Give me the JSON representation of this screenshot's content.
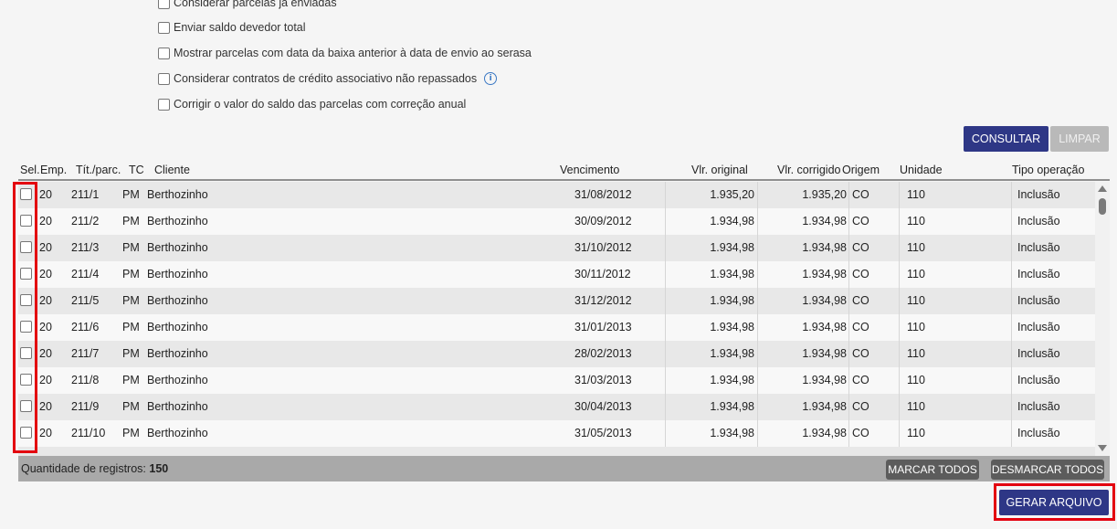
{
  "options": [
    {
      "label": "Considerar parcelas já enviadas"
    },
    {
      "label": "Enviar saldo devedor total"
    },
    {
      "label": "Mostrar parcelas com data da baixa anterior à data de envio ao serasa"
    },
    {
      "label": "Considerar contratos de crédito associativo não repassados"
    },
    {
      "label": "Corrigir o valor do saldo das parcelas com correção anual"
    }
  ],
  "info_icon": "info-icon",
  "buttons": {
    "consultar": "CONSULTAR",
    "limpar": "LIMPAR",
    "marcar_todos": "MARCAR TODOS",
    "desmarcar_todos": "DESMARCAR TODOS",
    "gerar_arquivo": "GERAR ARQUIVO"
  },
  "table": {
    "columns": {
      "sel": "Sel.",
      "emp": "Emp.",
      "tit": "Tít./parc.",
      "tc": "TC",
      "cliente": "Cliente",
      "vencimento": "Vencimento",
      "vlr_original": "Vlr. original",
      "vlr_corrigido": "Vlr. corrigido",
      "origem": "Origem",
      "unidade": "Unidade",
      "tipo_operacao": "Tipo operação"
    },
    "rows": [
      {
        "emp": "20",
        "tit": "211/1",
        "tc": "PM",
        "cliente": "Berthozinho",
        "vencimento": "31/08/2012",
        "vlr_original": "1.935,20",
        "vlr_corrigido": "1.935,20",
        "origem": "CO",
        "unidade": "110",
        "tipo": "Inclusão"
      },
      {
        "emp": "20",
        "tit": "211/2",
        "tc": "PM",
        "cliente": "Berthozinho",
        "vencimento": "30/09/2012",
        "vlr_original": "1.934,98",
        "vlr_corrigido": "1.934,98",
        "origem": "CO",
        "unidade": "110",
        "tipo": "Inclusão"
      },
      {
        "emp": "20",
        "tit": "211/3",
        "tc": "PM",
        "cliente": "Berthozinho",
        "vencimento": "31/10/2012",
        "vlr_original": "1.934,98",
        "vlr_corrigido": "1.934,98",
        "origem": "CO",
        "unidade": "110",
        "tipo": "Inclusão"
      },
      {
        "emp": "20",
        "tit": "211/4",
        "tc": "PM",
        "cliente": "Berthozinho",
        "vencimento": "30/11/2012",
        "vlr_original": "1.934,98",
        "vlr_corrigido": "1.934,98",
        "origem": "CO",
        "unidade": "110",
        "tipo": "Inclusão"
      },
      {
        "emp": "20",
        "tit": "211/5",
        "tc": "PM",
        "cliente": "Berthozinho",
        "vencimento": "31/12/2012",
        "vlr_original": "1.934,98",
        "vlr_corrigido": "1.934,98",
        "origem": "CO",
        "unidade": "110",
        "tipo": "Inclusão"
      },
      {
        "emp": "20",
        "tit": "211/6",
        "tc": "PM",
        "cliente": "Berthozinho",
        "vencimento": "31/01/2013",
        "vlr_original": "1.934,98",
        "vlr_corrigido": "1.934,98",
        "origem": "CO",
        "unidade": "110",
        "tipo": "Inclusão"
      },
      {
        "emp": "20",
        "tit": "211/7",
        "tc": "PM",
        "cliente": "Berthozinho",
        "vencimento": "28/02/2013",
        "vlr_original": "1.934,98",
        "vlr_corrigido": "1.934,98",
        "origem": "CO",
        "unidade": "110",
        "tipo": "Inclusão"
      },
      {
        "emp": "20",
        "tit": "211/8",
        "tc": "PM",
        "cliente": "Berthozinho",
        "vencimento": "31/03/2013",
        "vlr_original": "1.934,98",
        "vlr_corrigido": "1.934,98",
        "origem": "CO",
        "unidade": "110",
        "tipo": "Inclusão"
      },
      {
        "emp": "20",
        "tit": "211/9",
        "tc": "PM",
        "cliente": "Berthozinho",
        "vencimento": "30/04/2013",
        "vlr_original": "1.934,98",
        "vlr_corrigido": "1.934,98",
        "origem": "CO",
        "unidade": "110",
        "tipo": "Inclusão"
      },
      {
        "emp": "20",
        "tit": "211/10",
        "tc": "PM",
        "cliente": "Berthozinho",
        "vencimento": "31/05/2013",
        "vlr_original": "1.934,98",
        "vlr_corrigido": "1.934,98",
        "origem": "CO",
        "unidade": "110",
        "tipo": "Inclusão"
      }
    ]
  },
  "footer": {
    "count_label": "Quantidade de registros:",
    "count_value": "150"
  },
  "colors": {
    "primary_button": "#2e3786",
    "highlight": "#e3000f",
    "footer_bar": "#a9a9a9"
  }
}
